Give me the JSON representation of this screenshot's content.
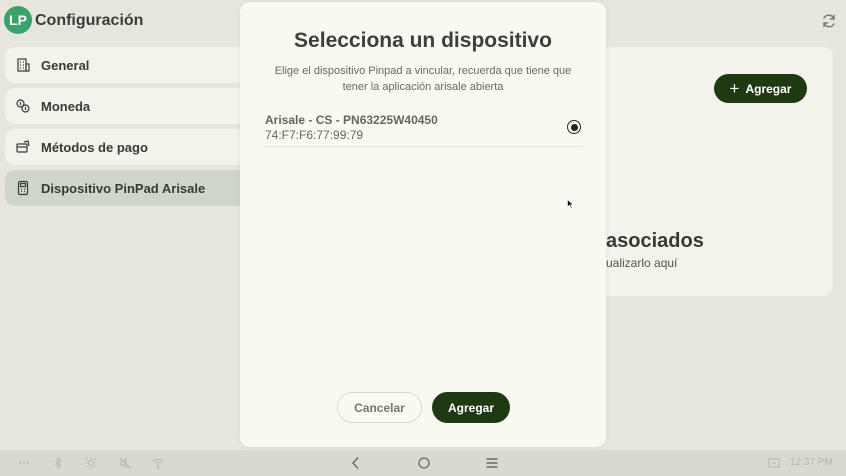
{
  "header": {
    "avatar_initials": "LP",
    "title": "Configuración",
    "refresh_icon": "refresh-icon"
  },
  "sidebar": {
    "items": [
      {
        "label": "General",
        "icon": "building-icon",
        "active": false
      },
      {
        "label": "Moneda",
        "icon": "currency-icon",
        "active": false
      },
      {
        "label": "Métodos de pago",
        "icon": "payment-methods-icon",
        "active": false
      },
      {
        "label": "Dispositivo PinPad Arisale",
        "icon": "pinpad-icon",
        "active": true
      }
    ]
  },
  "main": {
    "add_button_label": "Agregar",
    "empty_title": "asociados",
    "empty_subtitle": "ualizarlo aquí"
  },
  "modal": {
    "title": "Selecciona un dispositivo",
    "description": "Elige el dispositivo Pinpad a vincular, recuerda que tiene que tener la aplicación arisale abierta",
    "devices": [
      {
        "name": "Arisale - CS - PN63225W40450",
        "mac": "74:F7:F6:77:99:79",
        "selected": true
      }
    ],
    "cancel_label": "Cancelar",
    "add_label": "Agregar"
  },
  "system_bar": {
    "time": "12:37 PM"
  },
  "colors": {
    "accent": "#1f3a12",
    "avatar": "#3aa36b",
    "active_item": "#cfd6c9"
  }
}
